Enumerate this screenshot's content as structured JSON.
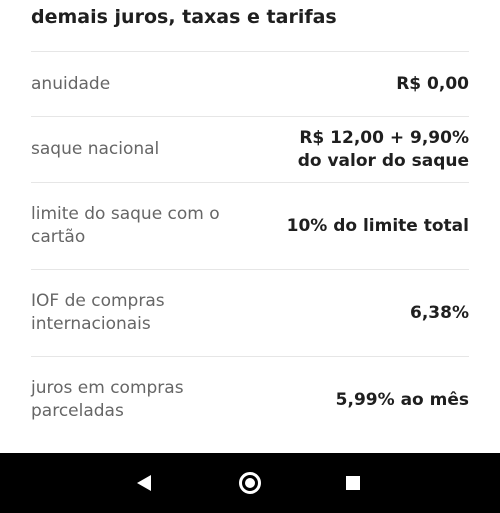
{
  "section": {
    "title": "demais juros, taxas e tarifas"
  },
  "fees": [
    {
      "label": "anuidade",
      "value": "R$ 0,00"
    },
    {
      "label": "saque nacional",
      "value": "R$ 12,00 + 9,90%\ndo valor do saque"
    },
    {
      "label": "limite do saque com o cartão",
      "value": "10% do limite total"
    },
    {
      "label": "IOF de compras internacionais",
      "value": "6,38%"
    },
    {
      "label": "juros em compras parceladas",
      "value": "5,99% ao mês"
    }
  ],
  "navbar": {
    "back_icon": "back-triangle-icon",
    "home_icon": "home-circle-icon",
    "recents_icon": "recents-square-icon"
  }
}
